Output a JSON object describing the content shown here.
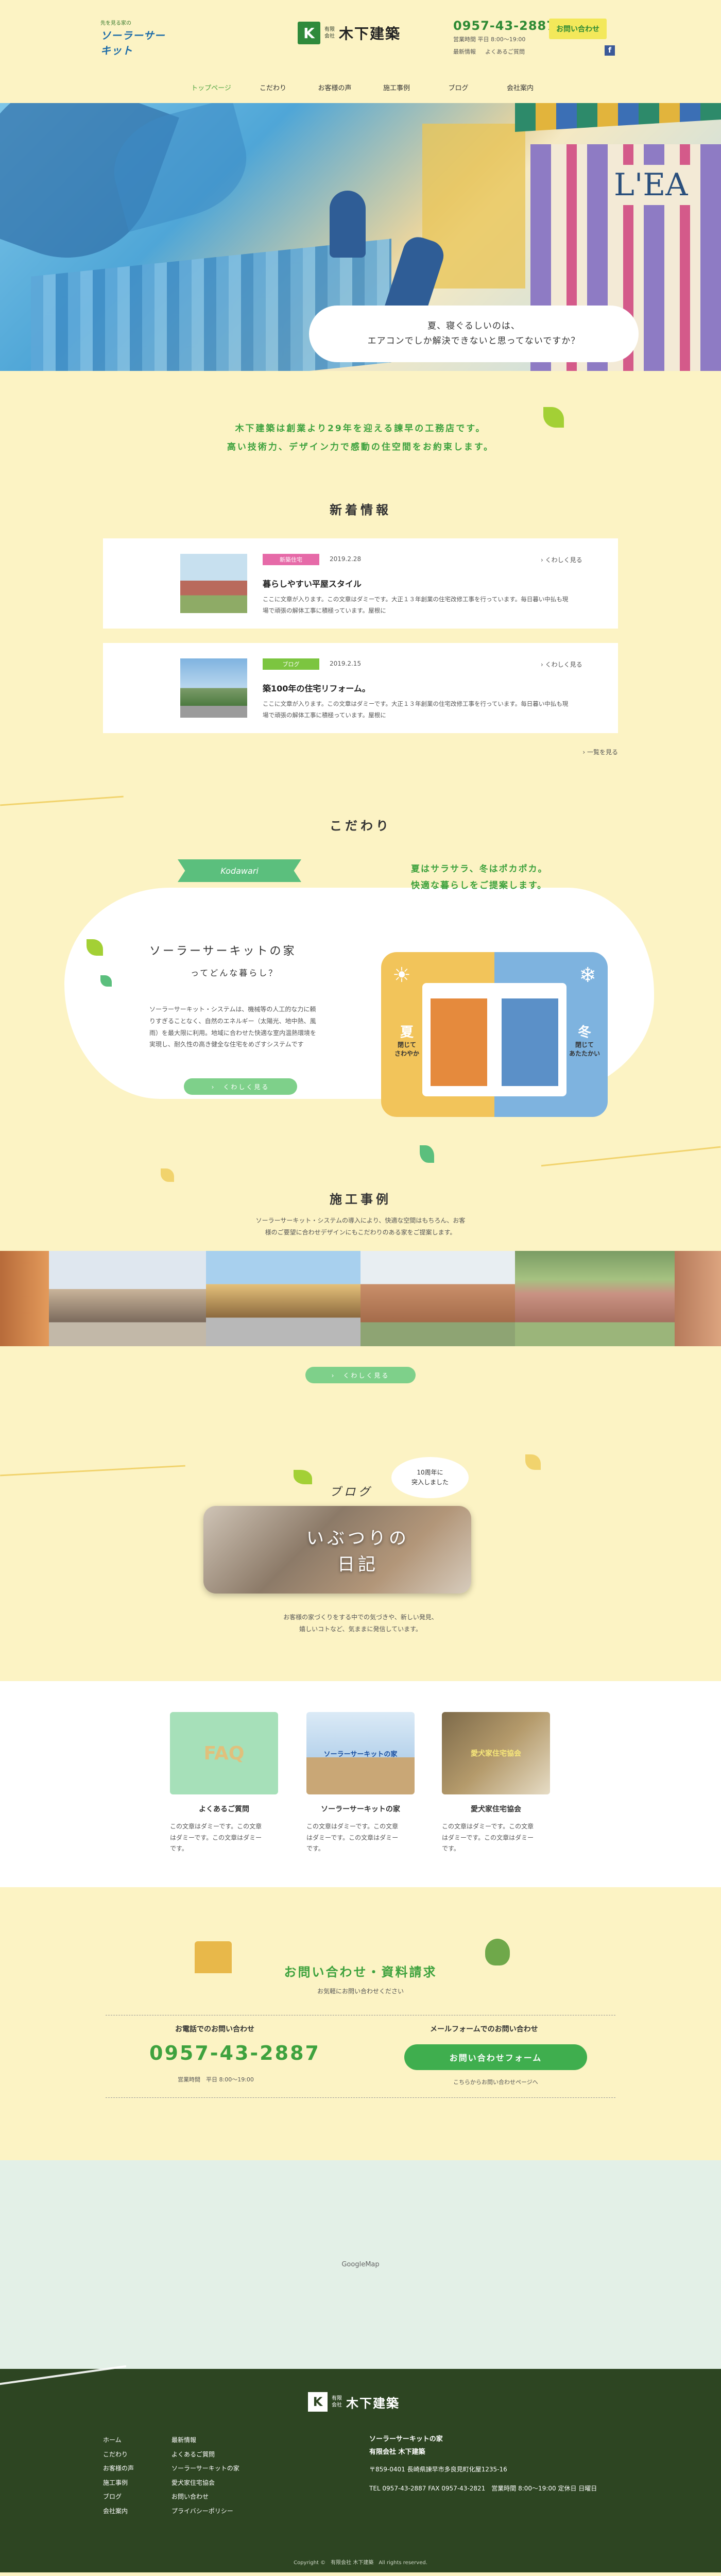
{
  "header": {
    "logo_small": "先を見る家の",
    "logo_big": "ソーラーサーキット",
    "company_mark": "K",
    "company_sub": "有限\n会社",
    "company_name": "木下建築",
    "tel": "0957-43-2887",
    "hours": "営業時間 平日 8:00〜19:00",
    "contact_btn": "お問い合わせ",
    "link_recent": "最新情報",
    "link_faq": "よくあるご質問",
    "fb": "f",
    "nav": [
      "トップページ",
      "こだわり",
      "お客様の声",
      "施工事例",
      "ブログ",
      "会社案内"
    ]
  },
  "hero": {
    "sign": "L'EA",
    "bubble_line1": "夏、寝ぐるしいのは、",
    "bubble_line2": "エアコンでしか解決できないと思ってないですか？"
  },
  "intro": {
    "line1": "木下建築は創業より29年を迎える諫早の工務店です。",
    "line2": "高い技術力、デザイン力で感動の住空間をお約束します。"
  },
  "news": {
    "title": "新着情報",
    "items": [
      {
        "badge": "新築住宅",
        "date": "2019.2.28",
        "more": "くわしく見る",
        "title": "暮らしやすい平屋スタイル",
        "text": "ここに文章が入ります。この文章はダミーです。大正１３年創業の住宅改修工事を行っています。毎日暮い中払も現場で頑張の解体工事に積極っています。屋根に"
      },
      {
        "badge": "ブログ",
        "date": "2019.2.15",
        "more": "くわしく見る",
        "title": "築100年の住宅リフォーム。",
        "text": "ここに文章が入ります。この文章はダミーです。大正１３年創業の住宅改修工事を行っています。毎日暮い中払も現場で頑張の解体工事に積極っています。屋根に"
      }
    ],
    "list_link": "一覧を見る"
  },
  "kodawari": {
    "title": "こだわり",
    "ribbon": "Kodawari",
    "tag1": "夏はサラサラ、冬はポカポカ。",
    "tag2": "快適な暮らしをご提案します。",
    "heading": "ソーラーサーキットの家",
    "sub": "ってどんな暮らし？",
    "text": "ソーラーサーキット・システムは、機械等の人工的な力に頼りすぎることなく、自然のエネルギー（太陽光、地中熱、風雨）を最大限に利用。地域に合わせた快適な室内温熱環境を実現し、耐久性の高き健全な住宅をめざすシステムです",
    "btn": "くわしく見る",
    "summer": "夏",
    "summer_text": "閉じて\nさわやか",
    "winter": "冬",
    "winter_text": "閉じて\nあたたかい"
  },
  "works": {
    "title": "施工事例",
    "text1": "ソーラーサーキット・システムの導入により、快適な空間はもちろん、お客",
    "text2": "様のご要望に合わせデザインにもこだわりのある家をご提案します。",
    "btn": "くわしく見る"
  },
  "blog": {
    "bubble": "10周年に\n突入しました",
    "title": "ブログ",
    "banner": "いぶつりの\n日記",
    "text1": "お客様の家づくりをする中での気づきや、新しい発見、",
    "text2": "嬉しいコトなど、気ままに発信しています。"
  },
  "links": [
    {
      "img": "FAQ",
      "caption": "よくあるご質問",
      "desc": "この文章はダミーです。この文章はダミーです。この文章はダミーです。"
    },
    {
      "img": "ソーラーサーキットの家",
      "caption": "ソーラーサーキットの家",
      "desc": "この文章はダミーです。この文章はダミーです。この文章はダミーです。"
    },
    {
      "img": "愛犬家住宅協会",
      "caption": "愛犬家住宅協会",
      "desc": "この文章はダミーです。この文章はダミーです。この文章はダミーです。"
    }
  ],
  "contact": {
    "title": "お問い合わせ・資料請求",
    "sub": "お気軽にお問い合わせください",
    "phone_heading": "お電話でのお問い合わせ",
    "phone": "0957-43-2887",
    "phone_hours": "営業時間　平日 8:00〜19:00",
    "form_heading": "メールフォームでのお問い合わせ",
    "form_btn": "お問い合わせフォーム",
    "form_note": "こちらからお問い合わせページへ"
  },
  "map": {
    "label": "GoogleMap"
  },
  "footer": {
    "mark": "K",
    "sub": "有限\n会社",
    "name": "木下建築",
    "col1": [
      "ホーム",
      "こだわり",
      "お客様の声",
      "施工事例",
      "ブログ",
      "会社案内"
    ],
    "col2": [
      "最新情報",
      "よくあるご質問",
      "ソーラーサーキットの家",
      "愛犬家住宅協会",
      "お問い合わせ",
      "プライバシーポリシー"
    ],
    "info_title": "ソーラーサーキットの家",
    "info_company": "有限会社 木下建築",
    "info_zip": "〒859-0401 長崎県諫早市多良見町化屋1235-16",
    "info_tel": "TEL 0957-43-2887 FAX 0957-43-2821　営業時間 8:00〜19:00 定休日 日曜日",
    "copyright": "Copyright ©　有限会社 木下建築　All rights reserved."
  }
}
